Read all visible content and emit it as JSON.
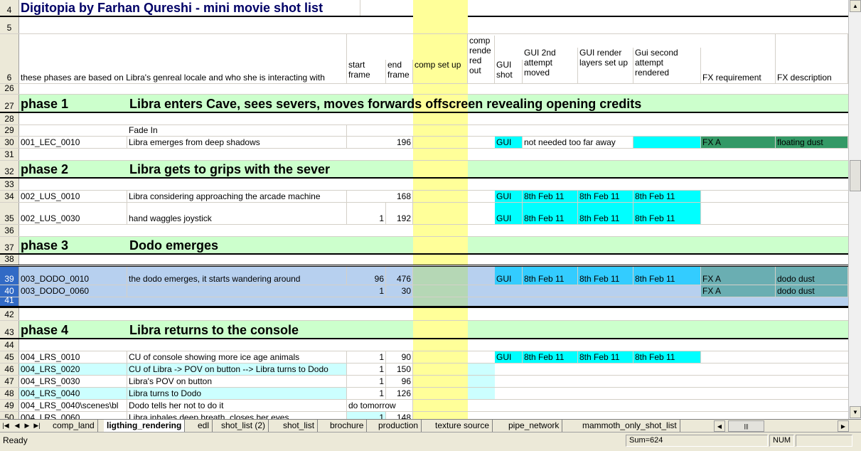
{
  "sheet": {
    "title": "Digitopia by Farhan Qureshi - mini movie shot list",
    "header_text": "these phases are based on Libra's genreal locale and who she is interacting with",
    "headers": {
      "start_frame": "start frame",
      "end_frame": "end frame",
      "comp_set_up": "comp set up",
      "comp_rendered_out": "comp rende red out",
      "gui_shot": "GUI shot",
      "gui_2nd": "GUI 2nd attempt moved",
      "gui_render_layers": "GUI render layers set up",
      "gui_second_rendered": "Gui second attempt rendered",
      "fx_requirement": "FX requirement",
      "fx_description": "FX description"
    },
    "row_numbers": [
      "4",
      "5",
      "6",
      "26",
      "27",
      "28",
      "29",
      "30",
      "31",
      "32",
      "33",
      "34",
      "35",
      "36",
      "37",
      "38",
      "39",
      "40",
      "41",
      "42",
      "43",
      "44",
      "45",
      "46",
      "47",
      "48",
      "49",
      "50"
    ],
    "phases": [
      {
        "label": "phase 1",
        "title": "Libra enters Cave, sees severs, moves forwards offscreen revealing opening credits"
      },
      {
        "label": "phase 2",
        "title": "Libra gets to grips with the sever"
      },
      {
        "label": "phase 3",
        "title": "Dodo emerges"
      },
      {
        "label": "phase 4",
        "title": "Libra returns to the console"
      }
    ],
    "rows": {
      "r29": {
        "desc": "Fade In"
      },
      "r30": {
        "shot": "001_LEC_0010",
        "desc": "Libra emerges from deep shadows",
        "end": "196",
        "gui": "GUI",
        "gui2": "not needed too far away",
        "fx": "FX A",
        "fxdesc": "floating dust"
      },
      "r34": {
        "shot": "002_LUS_0010",
        "desc": "Libra considering approaching the arcade machine",
        "end": "168",
        "gui": "GUI",
        "gui2": "8th Feb 11",
        "layers": "8th Feb 11",
        "gui3": "8th Feb 11"
      },
      "r35": {
        "shot": "002_LUS_0030",
        "desc": "hand waggles joystick",
        "start": "1",
        "end": "192",
        "gui": "GUI",
        "gui2": "8th Feb 11",
        "layers": "8th Feb 11",
        "gui3": "8th Feb 11"
      },
      "r39": {
        "shot": "003_DODO_0010",
        "desc": "the dodo emerges, it starts wandering around",
        "start": "96",
        "end": "476",
        "gui": "GUI",
        "gui2": "8th Feb 11",
        "layers": "8th Feb 11",
        "gui3": "8th Feb 11",
        "fx": "FX A",
        "fxdesc": "dodo dust"
      },
      "r40": {
        "shot": "003_DODO_0060",
        "start": "1",
        "end": "30",
        "fx": "FX A",
        "fxdesc": "dodo dust"
      },
      "r45": {
        "shot": "004_LRS_0010",
        "desc": "CU of console showing more ice age animals",
        "start": "1",
        "end": "90",
        "gui": "GUI",
        "gui2": "8th Feb 11",
        "layers": "8th Feb 11",
        "gui3": "8th Feb 11"
      },
      "r46": {
        "shot": "004_LRS_0020",
        "desc": "CU of Libra -> POV on button --> Libra turns to Dodo",
        "start": "1",
        "end": "150"
      },
      "r47": {
        "shot": "004_LRS_0030",
        "desc": "Libra's POV on button",
        "start": "1",
        "end": "96"
      },
      "r48": {
        "shot": "004_LRS_0040",
        "desc": "Libra turns to Dodo",
        "start": "1",
        "end": "126"
      },
      "r49": {
        "shot": "004_LRS_0040\\scenes\\bl",
        "desc": "Dodo tells her not to do it",
        "start": "do tomorrow"
      },
      "r50": {
        "shot": "004_LRS_0060",
        "desc": "Libra inhales deep breath, closes her eyes",
        "start": "1",
        "end": "148"
      }
    }
  },
  "tabs": [
    "comp_land",
    "ligthing_rendering",
    "edl",
    "shot_list (2)",
    "shot_list",
    "brochure",
    "production",
    "texture source",
    "pipe_network",
    "mammoth_only_shot_list"
  ],
  "active_tab": "ligthing_rendering",
  "status": {
    "ready": "Ready",
    "sum": "Sum=624",
    "num": "NUM"
  },
  "colors": {
    "phase_band": "#ccffcc",
    "gui_cyan": "#00ffff",
    "comp_yellow": "#ffff99",
    "selection": "#b7d0ef",
    "fx_green": "#339966",
    "fx_teal": "#6aaeb2"
  }
}
